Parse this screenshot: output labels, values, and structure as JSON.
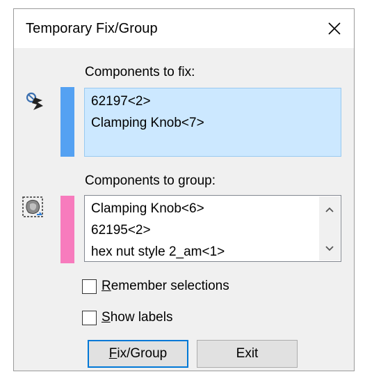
{
  "dialog": {
    "title": "Temporary Fix/Group",
    "close_icon": "close-icon"
  },
  "fix_section": {
    "label": "Components to fix:",
    "icon": "fix-components-icon",
    "color": "#54a1f2",
    "items": [
      "62197<2>",
      "Clamping Knob<7>"
    ]
  },
  "group_section": {
    "label": "Components to group:",
    "icon": "group-components-icon",
    "color": "#f77bbd",
    "items": [
      "Clamping Knob<6>",
      "62195<2>",
      "hex nut style 2_am<1>"
    ]
  },
  "options": {
    "remember_selections": {
      "label": "Remember selections",
      "checked": false
    },
    "show_labels": {
      "label": "Show labels",
      "checked": false
    }
  },
  "buttons": {
    "fix_group": "Fix/Group",
    "exit": "Exit"
  }
}
